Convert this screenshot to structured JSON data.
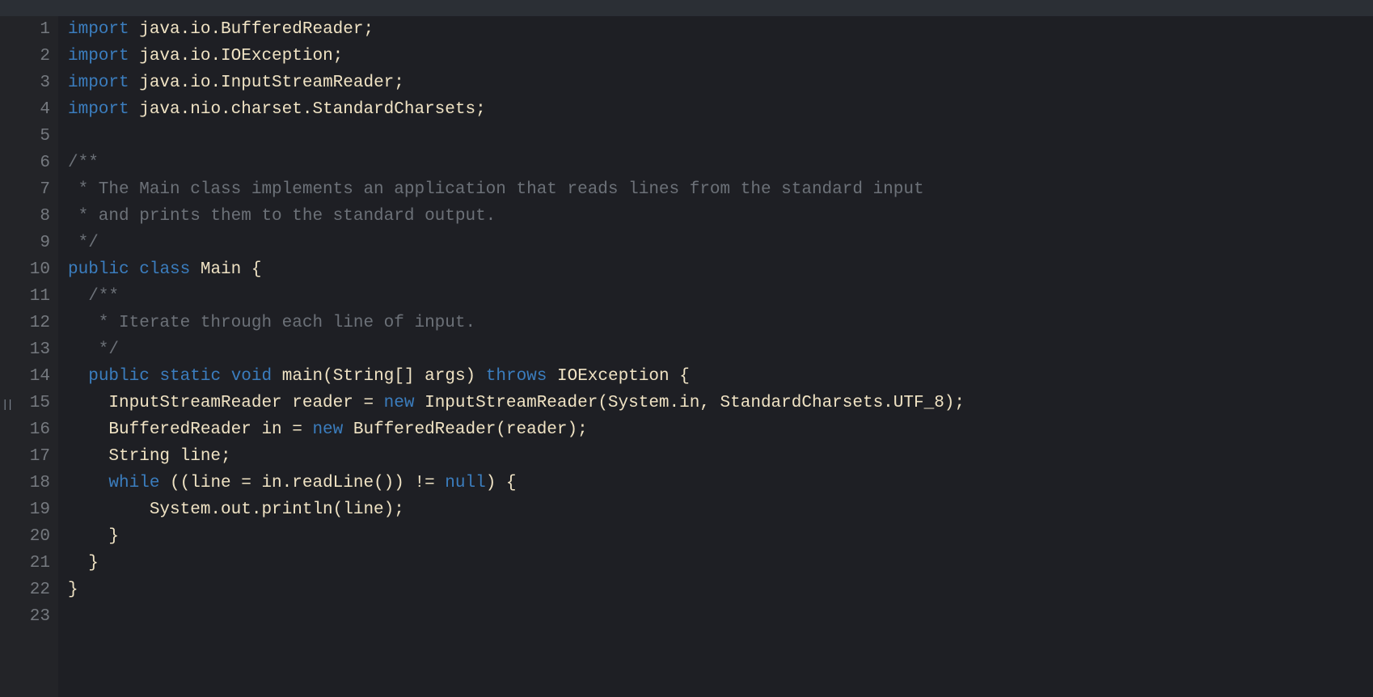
{
  "lineNumbers": [
    "1",
    "2",
    "3",
    "4",
    "5",
    "6",
    "7",
    "8",
    "9",
    "10",
    "11",
    "12",
    "13",
    "14",
    "15",
    "16",
    "17",
    "18",
    "19",
    "20",
    "21",
    "22",
    "23"
  ],
  "lines": [
    [
      {
        "c": "kw",
        "t": "import"
      },
      {
        "c": "pl",
        "t": " java.io.BufferedReader;"
      }
    ],
    [
      {
        "c": "kw",
        "t": "import"
      },
      {
        "c": "pl",
        "t": " java.io.IOException;"
      }
    ],
    [
      {
        "c": "kw",
        "t": "import"
      },
      {
        "c": "pl",
        "t": " java.io.InputStreamReader;"
      }
    ],
    [
      {
        "c": "kw",
        "t": "import"
      },
      {
        "c": "pl",
        "t": " java.nio.charset.StandardCharsets;"
      }
    ],
    [
      {
        "c": "pl",
        "t": ""
      }
    ],
    [
      {
        "c": "cm",
        "t": "/**"
      }
    ],
    [
      {
        "c": "cm",
        "t": " * The Main class implements an application that reads lines from the standard input"
      }
    ],
    [
      {
        "c": "cm",
        "t": " * and prints them to the standard output."
      }
    ],
    [
      {
        "c": "cm",
        "t": " */"
      }
    ],
    [
      {
        "c": "kw",
        "t": "public"
      },
      {
        "c": "pl",
        "t": " "
      },
      {
        "c": "kw",
        "t": "class"
      },
      {
        "c": "pl",
        "t": " Main {"
      }
    ],
    [
      {
        "c": "cm",
        "t": "  /**"
      }
    ],
    [
      {
        "c": "cm",
        "t": "   * Iterate through each line of input."
      }
    ],
    [
      {
        "c": "cm",
        "t": "   */"
      }
    ],
    [
      {
        "c": "pl",
        "t": "  "
      },
      {
        "c": "kw",
        "t": "public"
      },
      {
        "c": "pl",
        "t": " "
      },
      {
        "c": "kw",
        "t": "static"
      },
      {
        "c": "pl",
        "t": " "
      },
      {
        "c": "kw",
        "t": "void"
      },
      {
        "c": "pl",
        "t": " main(String[] args) "
      },
      {
        "c": "kw",
        "t": "throws"
      },
      {
        "c": "pl",
        "t": " IOException {"
      }
    ],
    [
      {
        "c": "pl",
        "t": "    InputStreamReader reader = "
      },
      {
        "c": "kw",
        "t": "new"
      },
      {
        "c": "pl",
        "t": " InputStreamReader(System.in, StandardCharsets.UTF_8);"
      }
    ],
    [
      {
        "c": "pl",
        "t": "    BufferedReader in = "
      },
      {
        "c": "kw",
        "t": "new"
      },
      {
        "c": "pl",
        "t": " BufferedReader(reader);"
      }
    ],
    [
      {
        "c": "pl",
        "t": "    String line;"
      }
    ],
    [
      {
        "c": "pl",
        "t": "    "
      },
      {
        "c": "kw",
        "t": "while"
      },
      {
        "c": "pl",
        "t": " ((line = in.readLine()) != "
      },
      {
        "c": "kw",
        "t": "null"
      },
      {
        "c": "pl",
        "t": ") {"
      }
    ],
    [
      {
        "c": "pl",
        "t": "        System.out.println(line);"
      }
    ],
    [
      {
        "c": "pl",
        "t": "    }"
      }
    ],
    [
      {
        "c": "pl",
        "t": "  }"
      }
    ],
    [
      {
        "c": "pl",
        "t": "}"
      }
    ],
    [
      {
        "c": "pl",
        "t": ""
      }
    ]
  ],
  "handleGlyph": "||"
}
